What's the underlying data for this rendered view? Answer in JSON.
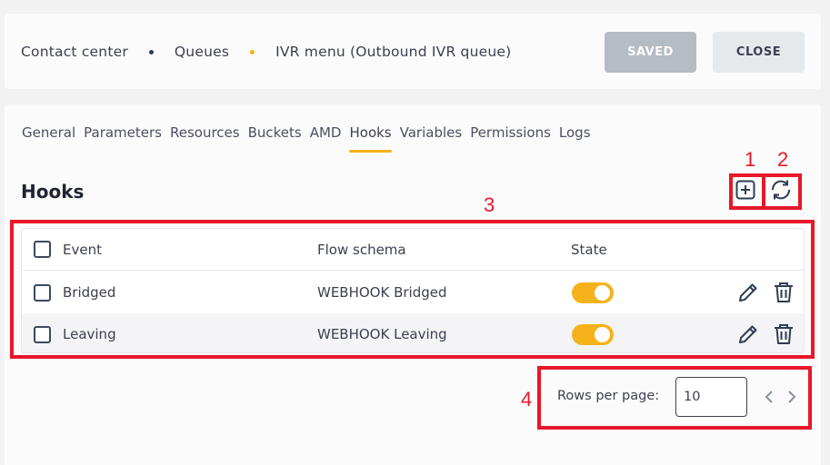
{
  "header": {
    "breadcrumbs": [
      "Contact center",
      "Queues",
      "IVR menu (Outbound IVR queue)"
    ],
    "saved_label": "SAVED",
    "close_label": "CLOSE"
  },
  "tabs": [
    {
      "label": "General"
    },
    {
      "label": "Parameters"
    },
    {
      "label": "Resources"
    },
    {
      "label": "Buckets"
    },
    {
      "label": "AMD"
    },
    {
      "label": "Hooks",
      "active": true
    },
    {
      "label": "Variables"
    },
    {
      "label": "Permissions"
    },
    {
      "label": "Logs"
    }
  ],
  "section": {
    "title": "Hooks",
    "add_icon": "plus-square-icon",
    "refresh_icon": "refresh-icon"
  },
  "table": {
    "columns": [
      "Event",
      "Flow schema",
      "State"
    ],
    "rows": [
      {
        "event": "Bridged",
        "flow_schema": "WEBHOOK Bridged",
        "state": true
      },
      {
        "event": "Leaving",
        "flow_schema": "WEBHOOK Leaving",
        "state": true
      }
    ]
  },
  "pagination": {
    "rows_per_page_label": "Rows per page:",
    "rows_per_page_value": "10"
  },
  "annotations": [
    "1",
    "2",
    "3",
    "4"
  ],
  "colors": {
    "accent": "#f5b21a",
    "annotation": "#e8172a",
    "saved_button": "#b4bcc4",
    "close_button": "#e6e9ec"
  }
}
